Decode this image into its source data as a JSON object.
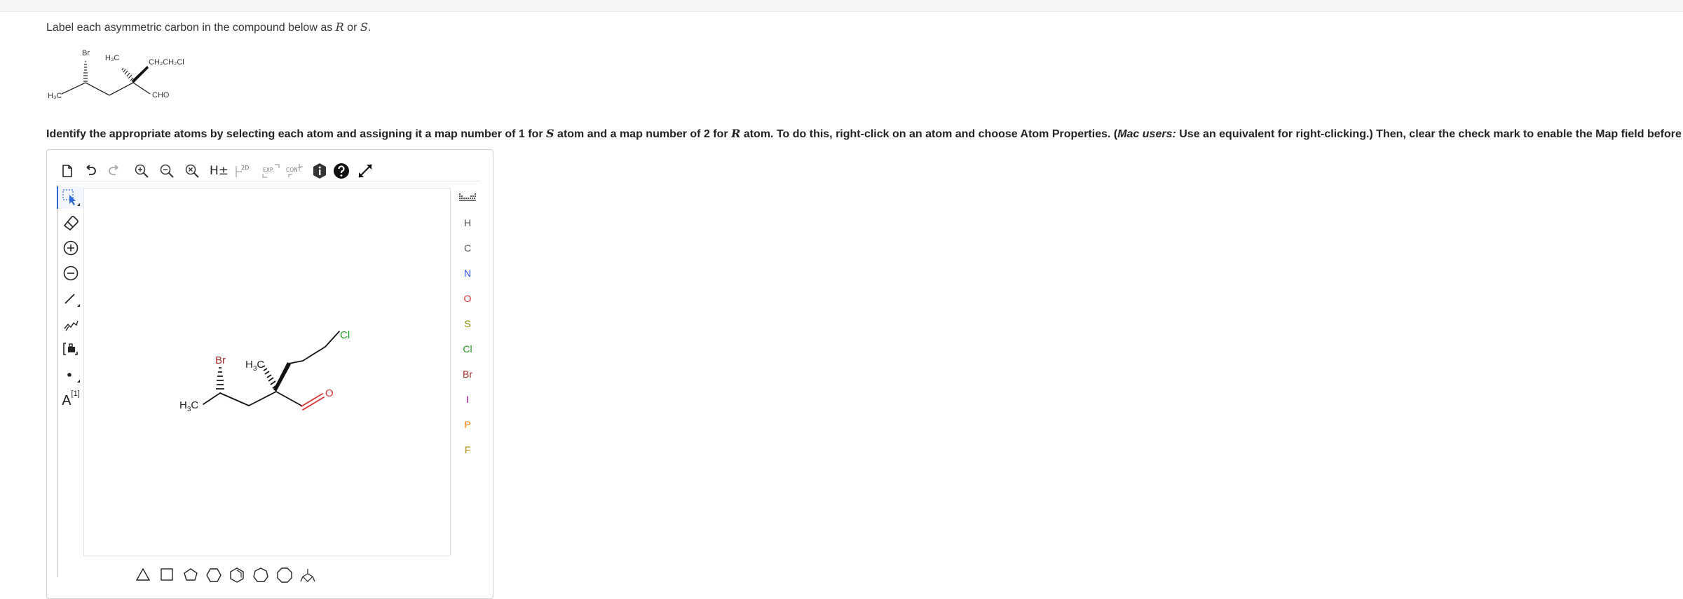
{
  "question1": {
    "text_before": "Label each asymmetric carbon in the compound below as ",
    "r": "R",
    "or": " or ",
    "s": "S",
    "period": "."
  },
  "question2": {
    "part1": "Identify the appropriate atoms by selecting each atom and assigning it a map number of 1 for ",
    "s": "S",
    "part2": " atom and a map number of 2 for ",
    "r": "R",
    "part3": " atom. To do this, right-click on an atom and choose Atom Properties. (",
    "mac_users": "Mac users:",
    "part4": " Use an equivalent for right-clicking.) Then, clear the check mark to enable the Map field before entering"
  },
  "static_molecule": {
    "br": "Br",
    "h3c_top": "H₃C",
    "ch2ch2cl": "CH₂CH₂Cl",
    "h3c_left": "H₃C",
    "cho": "CHO"
  },
  "toolbar": {
    "h_label": "H±",
    "twod_label": "2D",
    "exp_label": "EXP.",
    "cont_label": "CONT."
  },
  "left_tools": {
    "atom_map_label": "A",
    "atom_map_sup": "[1]"
  },
  "atoms": [
    "H",
    "C",
    "N",
    "O",
    "S",
    "Cl",
    "Br",
    "I",
    "P",
    "F"
  ],
  "atom_colors": {
    "H": "#555555",
    "C": "#555555",
    "N": "#3050f8",
    "O": "#e03030",
    "S": "#8a8a00",
    "Cl": "#1f9a1f",
    "Br": "#a62929",
    "I": "#940094",
    "P": "#ff8000",
    "F": "#b08a00"
  },
  "canvas_molecule": {
    "br": "Br",
    "h3c_top": "H",
    "h3c_top_sub": "3",
    "h3c_top_c": "C",
    "h3c_left": "H",
    "h3c_left_sub": "3",
    "h3c_left_c": "C",
    "cl": "Cl",
    "o": "O"
  }
}
